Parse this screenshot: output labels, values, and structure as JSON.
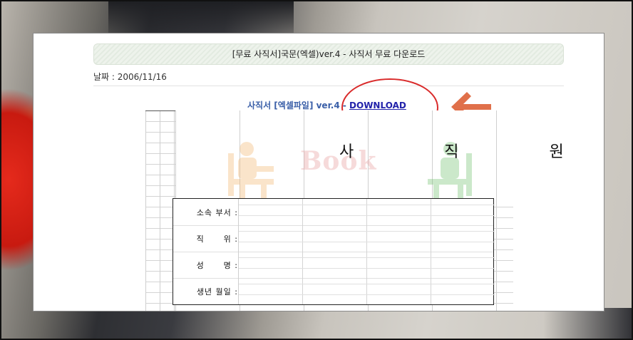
{
  "page": {
    "title_bar": "[무료 사직서]국문(엑셀)ver.4 - 사직서 무료 다운로드",
    "date_label": "날짜 : 2006/11/16",
    "download_prefix": "사직서 [엑셀파일] ver.4 - ",
    "download_link": "DOWNLOAD"
  },
  "document": {
    "title": "사 직 원",
    "watermark": "Book",
    "fields": [
      {
        "label": "소속 부서 :"
      },
      {
        "label": "직      위 :"
      },
      {
        "label": "성      명 :"
      },
      {
        "label": "생년 월일 :"
      }
    ]
  },
  "annotation": {
    "circle_color": "#d92b2b",
    "arrow_color": "#e0704a"
  },
  "icons": {
    "arrow": "left-arrow-icon",
    "watermark_left": "chair-figure-icon",
    "watermark_right": "chair-figure-icon"
  }
}
